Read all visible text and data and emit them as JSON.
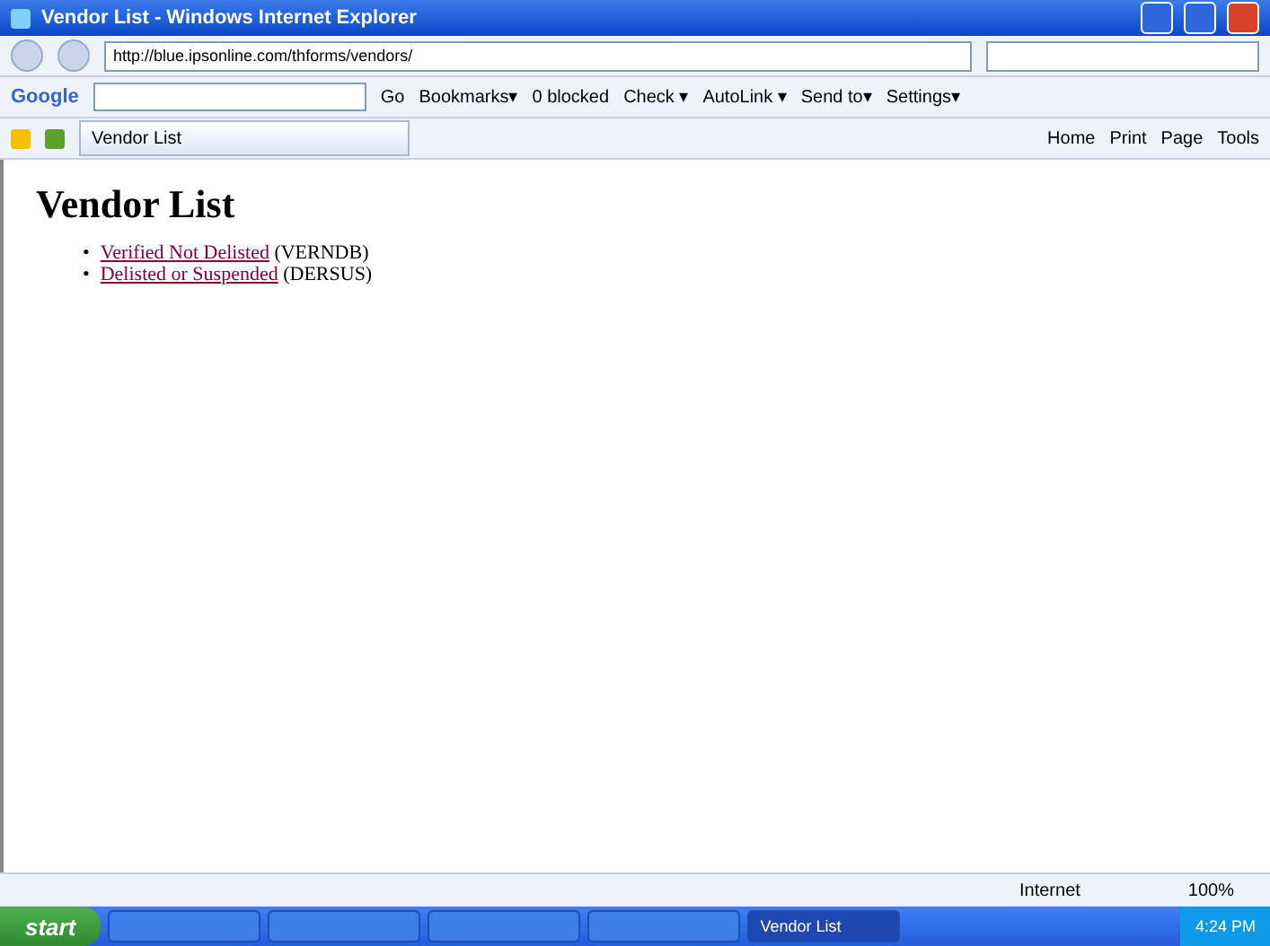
{
  "window": {
    "title": "Vendor List - Windows Internet Explorer"
  },
  "address_bar": {
    "url": "http://blue.ipsonline.com/thforms/vendors/"
  },
  "google_toolbar": {
    "logo": "Google",
    "items": [
      {
        "label": "Go"
      },
      {
        "label": "Bookmarks▾"
      },
      {
        "label": "0 blocked"
      },
      {
        "label": "Check ▾"
      },
      {
        "label": "AutoLink ▾"
      },
      {
        "label": "Send to▾"
      },
      {
        "label": "Settings▾"
      }
    ]
  },
  "tabs": [
    {
      "label": "Vendor List",
      "selected": true
    }
  ],
  "command_bar": [
    {
      "label": "Home"
    },
    {
      "label": "Print"
    },
    {
      "label": "Page"
    },
    {
      "label": "Tools"
    }
  ],
  "page": {
    "heading": "Vendor List",
    "items": [
      {
        "bullet": "•",
        "link": "Verified Not Delisted",
        "code": "(VERNDB)"
      },
      {
        "bullet": "•",
        "link": "Delisted or Suspended",
        "code": "(DERSUS)"
      }
    ]
  },
  "status_bar": {
    "zone": "Internet",
    "zoom": "100%"
  },
  "taskbar": {
    "start": "start",
    "tasks": [
      {
        "selected": false
      },
      {
        "selected": false
      },
      {
        "selected": false
      },
      {
        "selected": false
      },
      {
        "label": "Vendor List",
        "selected": true
      }
    ],
    "clock": "4:24 PM"
  }
}
